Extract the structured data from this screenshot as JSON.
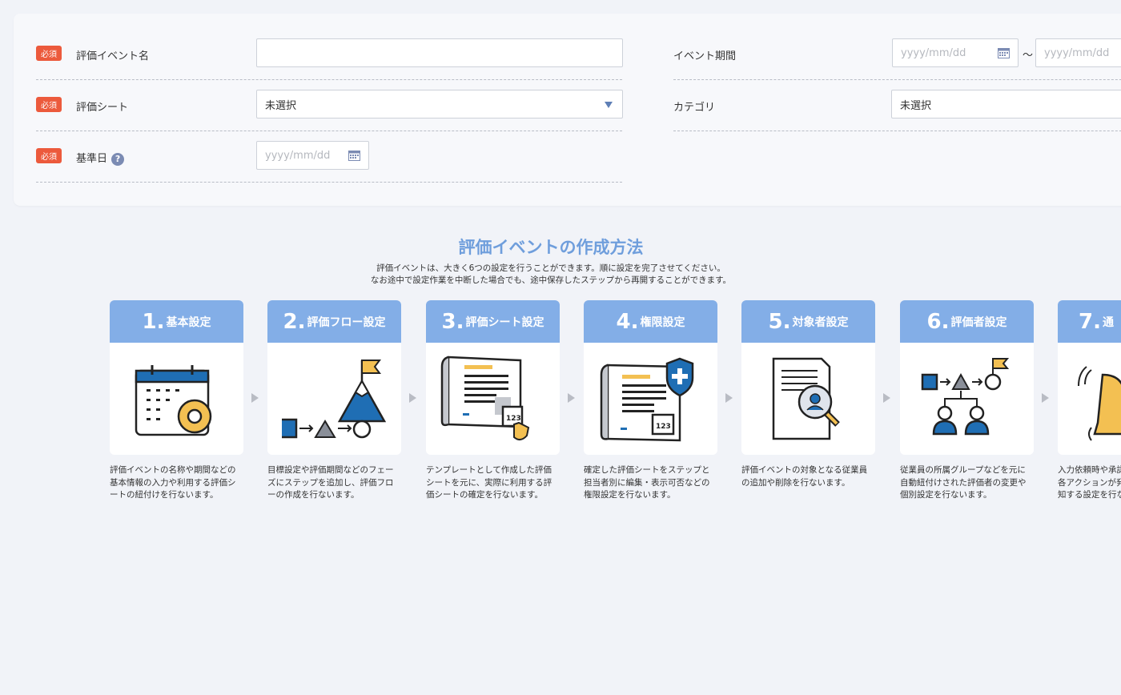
{
  "form": {
    "required_badge": "必須",
    "event_name_label": "評価イベント名",
    "event_name_value": "",
    "sheet_label": "評価シート",
    "sheet_value": "未選択",
    "base_date_label": "基準日",
    "help_glyph": "?",
    "date_placeholder": "yyyy/mm/dd",
    "period_label": "イベント期間",
    "period_separator": "〜",
    "category_label": "カテゴリ",
    "category_value": "未選択"
  },
  "guide": {
    "title": "評価イベントの作成方法",
    "subtitle_line1": "評価イベントは、大きく6つの設定を行うことができます。順に設定を完了させてください。",
    "subtitle_line2": "なお途中で設定作業を中断した場合でも、途中保存したステップから再開することができます。",
    "steps": [
      {
        "num": "1.",
        "label": "基本設定",
        "icon": "calendar-gear-icon",
        "desc": [
          "評価イベントの名称や期間などの",
          "基本情報の入力や利用する評価シ",
          "ートの紐付けを行ないます。"
        ]
      },
      {
        "num": "2.",
        "label": "評価フロー設定",
        "icon": "flow-mountain-icon",
        "desc": [
          "目標設定や評価期間などのフェー",
          "ズにステップを追加し、評価フロ",
          "ーの作成を行ないます。"
        ]
      },
      {
        "num": "3.",
        "label": "評価シート設定",
        "icon": "sheet-template-icon",
        "desc": [
          "テンプレートとして作成した評価",
          "シートを元に、実際に利用する評",
          "価シートの確定を行ないます。"
        ]
      },
      {
        "num": "4.",
        "label": "権限設定",
        "icon": "sheet-shield-icon",
        "desc": [
          "確定した評価シートをステップと",
          "担当者別に編集・表示可否などの",
          "権限設定を行ないます。"
        ]
      },
      {
        "num": "5.",
        "label": "対象者設定",
        "icon": "document-search-person-icon",
        "desc": [
          "評価イベントの対象となる従業員",
          "の追加や削除を行ないます。"
        ]
      },
      {
        "num": "6.",
        "label": "評価者設定",
        "icon": "flow-people-icon",
        "desc": [
          "従業員の所属グループなどを元に",
          "自動紐付けされた評価者の変更や",
          "個別設定を行ないます。"
        ]
      },
      {
        "num": "7.",
        "label": "通",
        "icon": "bell-icon",
        "desc": [
          "入力依頼時や承認",
          "各アクションが発",
          "知する設定を行な"
        ]
      }
    ]
  }
}
